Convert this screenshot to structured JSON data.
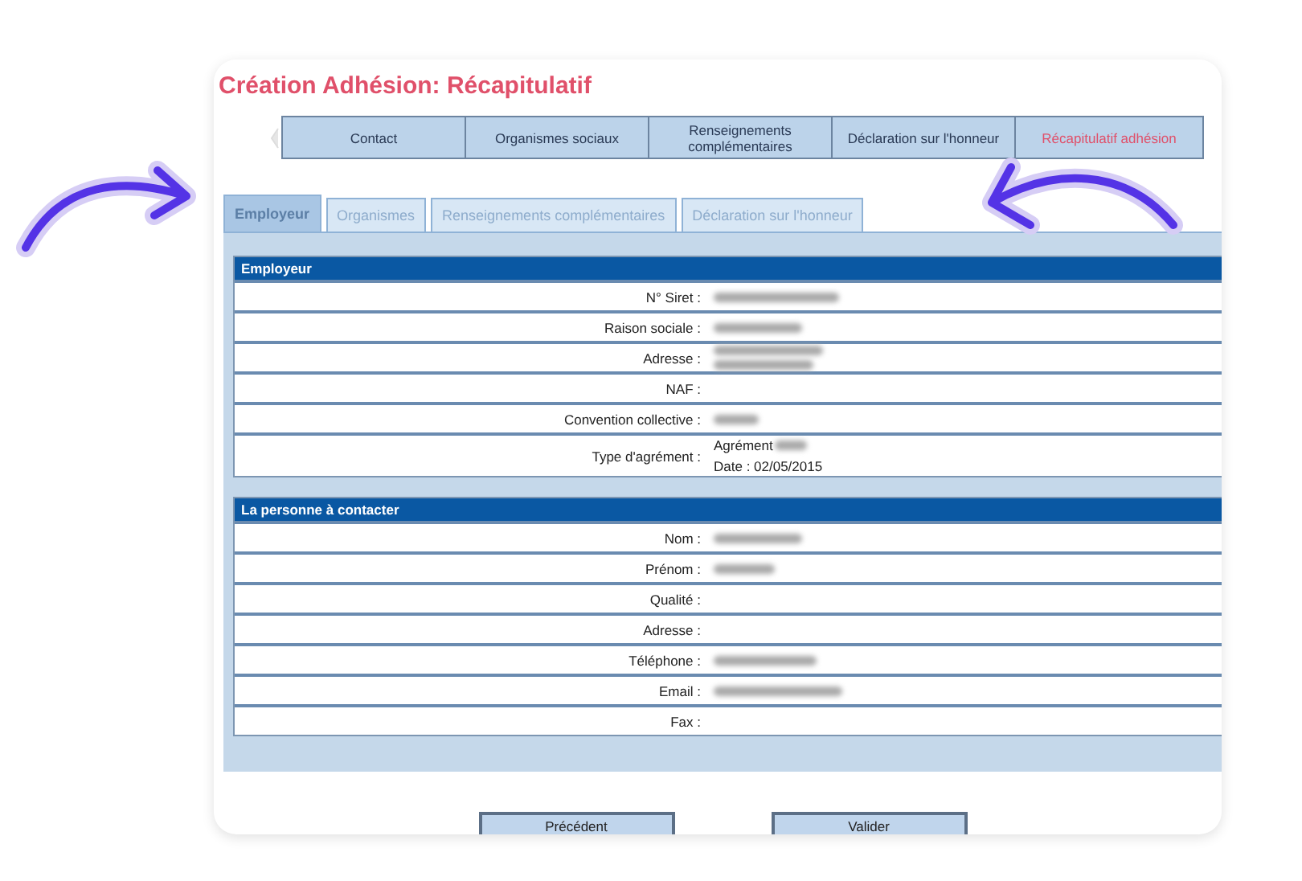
{
  "title": "Création Adhésion: Récapitulatif",
  "steps": [
    {
      "label": "Contact",
      "selected": false
    },
    {
      "label": "Organismes sociaux",
      "selected": false
    },
    {
      "label": "Renseignements complémentaires",
      "selected": false
    },
    {
      "label": "Déclaration sur l'honneur",
      "selected": false
    },
    {
      "label": "Récapitulatif adhésion",
      "selected": true
    }
  ],
  "tabs": [
    {
      "label": "Employeur",
      "selected": true
    },
    {
      "label": "Organismes",
      "selected": false
    },
    {
      "label": "Renseignements complémentaires",
      "selected": false
    },
    {
      "label": "Déclaration sur l'honneur",
      "selected": false
    }
  ],
  "sections": [
    {
      "heading": "Employeur",
      "rows": [
        {
          "label": "N° Siret :",
          "lines": [
            {
              "blurred": true
            }
          ]
        },
        {
          "label": "Raison sociale :",
          "lines": [
            {
              "blurred": true
            }
          ]
        },
        {
          "label": "Adresse :",
          "lines": [
            {
              "blurred": true
            },
            {
              "blurred": true
            }
          ]
        },
        {
          "label": "NAF :",
          "lines": []
        },
        {
          "label": "Convention collective :",
          "lines": [
            {
              "blurred": true
            }
          ]
        },
        {
          "label": "Type d'agrément :",
          "lines": [
            {
              "text": "Agrément",
              "blurred": true
            },
            {
              "text": "Date : 02/05/2015",
              "blurred": false
            }
          ]
        }
      ]
    },
    {
      "heading": "La personne à contacter",
      "rows": [
        {
          "label": "Nom :",
          "lines": [
            {
              "blurred": true
            }
          ]
        },
        {
          "label": "Prénom :",
          "lines": [
            {
              "blurred": true
            }
          ]
        },
        {
          "label": "Qualité :",
          "lines": []
        },
        {
          "label": "Adresse :",
          "lines": []
        },
        {
          "label": "Téléphone :",
          "lines": [
            {
              "blurred": true
            }
          ]
        },
        {
          "label": "Email :",
          "lines": [
            {
              "blurred": true
            }
          ]
        },
        {
          "label": "Fax :",
          "lines": []
        }
      ]
    }
  ],
  "buttons": [
    "Précédent",
    "Valider"
  ]
}
